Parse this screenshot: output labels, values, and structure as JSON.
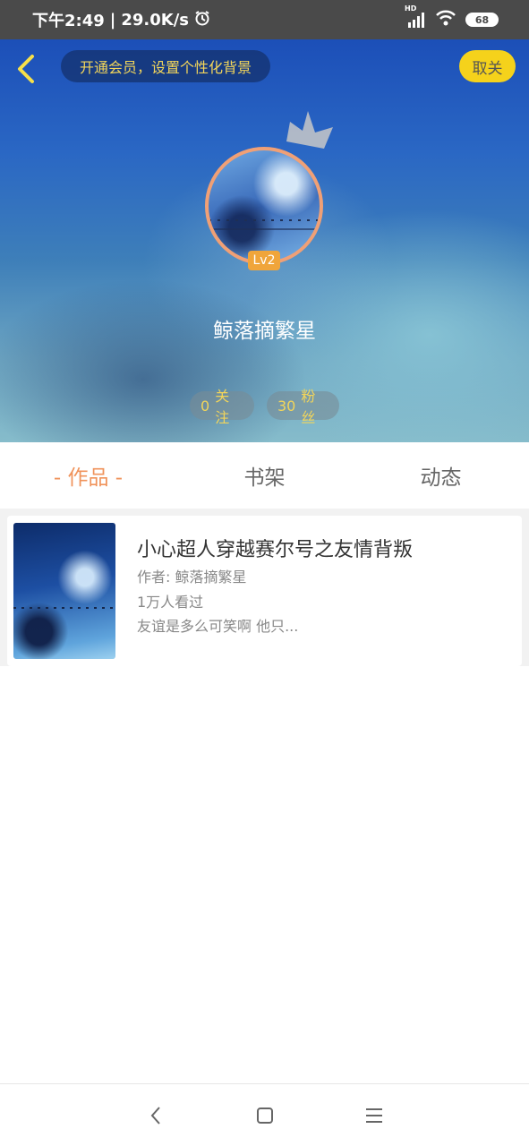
{
  "status_bar": {
    "time": "下午2:49",
    "separator": "|",
    "speed": "29.0K/s",
    "network": "HD",
    "battery": "68"
  },
  "header": {
    "vip_banner": "开通会员，设置个性化背景",
    "unfollow_label": "取关"
  },
  "profile": {
    "level": "Lv2",
    "username": "鲸落摘繁星",
    "following_count": "0",
    "following_label": "关注",
    "fans_count": "30",
    "fans_label": "粉丝"
  },
  "tabs": [
    {
      "label": "- 作品 -",
      "active": true
    },
    {
      "label": "书架",
      "active": false
    },
    {
      "label": "动态",
      "active": false
    }
  ],
  "books": [
    {
      "title": "小心超人穿越赛尔号之友情背叛",
      "author": "作者: 鲸落摘繁星",
      "views": "1万人看过",
      "description": "友谊是多么可笑啊 他只..."
    }
  ],
  "colors": {
    "accent_orange": "#f0935b",
    "accent_yellow": "#f5d21b",
    "vip_text": "#f3d65a"
  }
}
